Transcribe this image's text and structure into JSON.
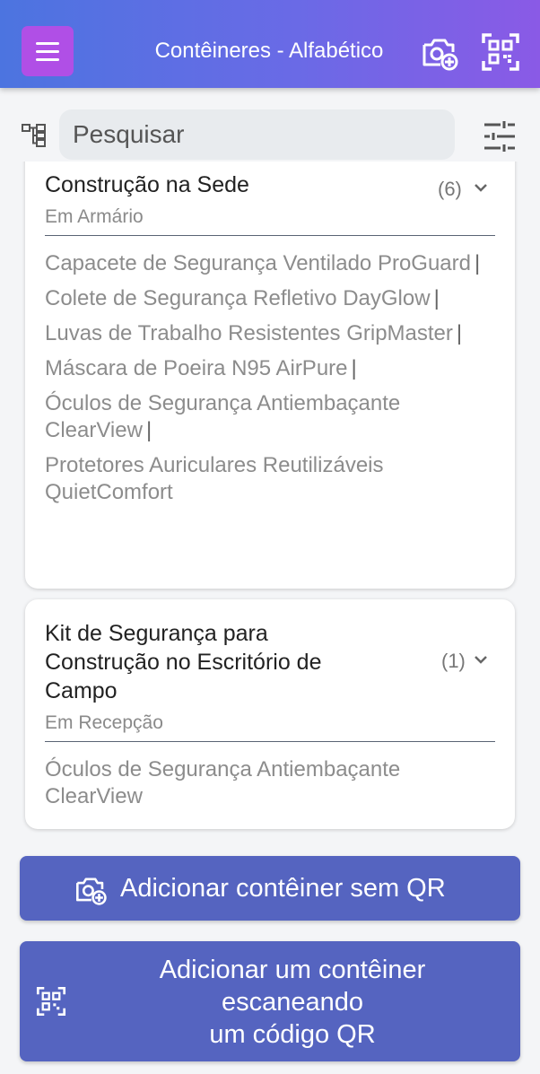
{
  "header": {
    "title": "Contêineres - Alfabético",
    "menu_icon": "hamburger-menu-icon",
    "add_container_icon": "camera-plus-icon",
    "scan_qr_icon": "qr-scan-icon",
    "menu_color": "#b04fe6"
  },
  "search": {
    "placeholder": "Pesquisar",
    "tree_icon": "tree-structure-icon",
    "filter_icon": "filter-sliders-icon"
  },
  "containers": [
    {
      "title": "Construção na Sede",
      "count": "(6)",
      "location": "Em Armário",
      "items": [
        "Capacete de Segurança Ventilado ProGuard",
        "Colete de Segurança Refletivo DayGlow",
        "Luvas de Trabalho Resistentes GripMaster",
        "Máscara de Poeira N95 AirPure",
        "Óculos de Segurança Antiembaçante ClearView",
        "Protetores Auriculares Reutilizáveis QuietComfort"
      ]
    },
    {
      "title_lines": [
        "Kit de Segurança para",
        "Construção no Escritório de",
        "Campo"
      ],
      "count": "(1)",
      "location": "Em Recepção",
      "items": [
        "Óculos de Segurança Antiembaçante ClearView"
      ]
    }
  ],
  "buttons": {
    "add_without_qr": "Adicionar contêiner sem QR",
    "add_with_qr_lines": [
      "Adicionar um contêiner",
      "escaneando",
      "um código QR"
    ]
  },
  "colors": {
    "header_gradient_start": "#4c74e0",
    "header_gradient_end": "#8a5ae6",
    "button_bg": "#5564c0",
    "card_bg": "#ffffff"
  }
}
